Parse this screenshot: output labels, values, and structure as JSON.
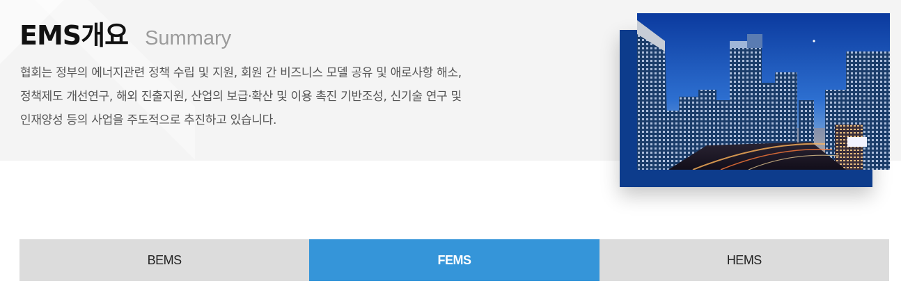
{
  "header": {
    "title": "EMS개요",
    "subtitle": "Summary"
  },
  "description": {
    "lines": [
      "협회는 정부의 에너지관련 정책 수립 및 지원, 회원 간 비즈니스 모델 공유 및 애로사항 해소,",
      "정책제도 개선연구, 해외 진출지원, 산업의 보급·확산 및 이용 촉진 기반조성, 신기술 연구 및",
      "인재양성 등의 사업을 주도적으로 추진하고 있습니다."
    ]
  },
  "image": {
    "icon": "city-skyline-night-photo"
  },
  "tabs": [
    {
      "label": "BEMS",
      "active": false
    },
    {
      "label": "FEMS",
      "active": true
    },
    {
      "label": "HEMS",
      "active": false
    }
  ],
  "colors": {
    "band_background": "#f4f4f4",
    "photo_frame": "#0d3c8c",
    "tab_inactive": "#dcdcdc",
    "tab_active": "#3595d9"
  }
}
